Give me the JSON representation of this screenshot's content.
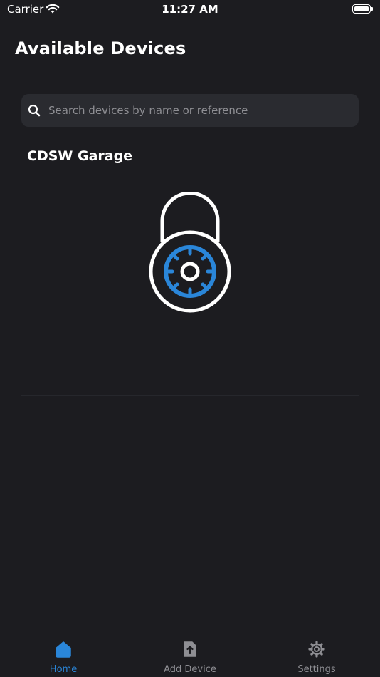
{
  "status_bar": {
    "carrier": "Carrier",
    "time": "11:27 AM"
  },
  "header": {
    "title": "Available Devices"
  },
  "search": {
    "placeholder": "Search devices by name or reference",
    "value": ""
  },
  "devices": [
    {
      "name": "CDSW Garage",
      "icon": "padlock-icon"
    }
  ],
  "tabs": [
    {
      "label": "Home",
      "icon": "home-icon",
      "active": true
    },
    {
      "label": "Add Device",
      "icon": "upload-file-icon",
      "active": false
    },
    {
      "label": "Settings",
      "icon": "gear-icon",
      "active": false
    }
  ],
  "colors": {
    "background": "#1c1c20",
    "accent": "#2a86d9",
    "inactive": "#8e8e93",
    "search_field": "#2a2b30"
  }
}
